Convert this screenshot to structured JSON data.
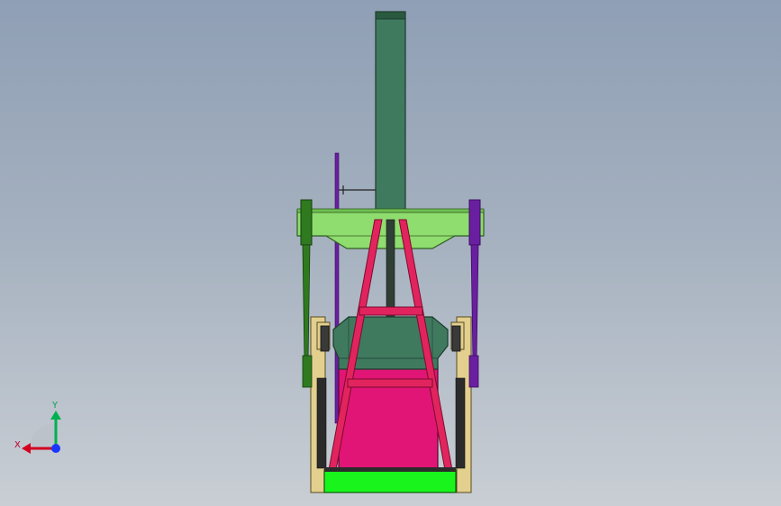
{
  "viewport": {
    "background_top": "#8f9fb5",
    "background_bottom": "#c9ced4"
  },
  "model": {
    "name": "pump-jack-front-view",
    "colors": {
      "walking_beam": "#3f7a5f",
      "beam_cap": "#2a5a40",
      "crossbeam": "#8fdc6f",
      "samson_post": "#e2245e",
      "gear_box": "#3f7a5f",
      "gear_box_base": "#e01575",
      "left_pitman": "#2f7a1f",
      "right_pitman": "#6a1fa0",
      "crank_frame": "#e3cf8e",
      "skid_base": "#19f51c",
      "polished_rod": "#6a1fa0",
      "counterweight": "#2b2b2b"
    }
  },
  "triad": {
    "x_label": "X",
    "y_label": "Y",
    "x_color": "#d4001f",
    "y_color": "#00b050",
    "z_color": "#1a35ff"
  }
}
